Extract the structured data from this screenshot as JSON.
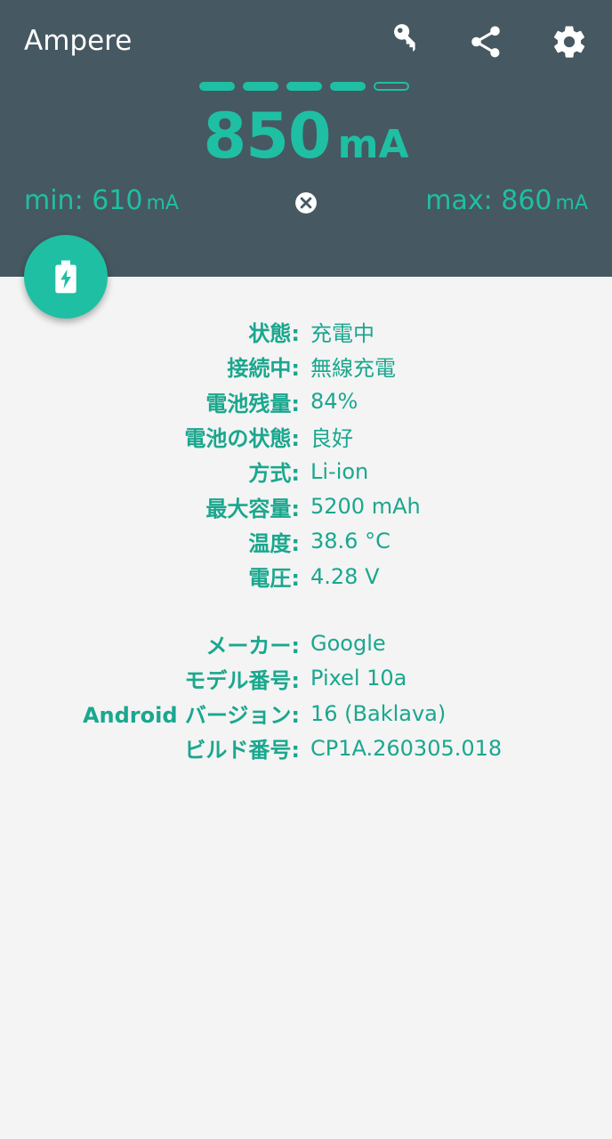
{
  "app": {
    "title": "Ampere"
  },
  "toolbar": {
    "icons": [
      "key-icon",
      "share-icon",
      "settings-icon"
    ]
  },
  "meter": {
    "segments_filled": 4,
    "segments_total": 5,
    "current_value": "850",
    "current_unit": "mA",
    "min_label": "min: 610",
    "min_unit": "mA",
    "max_label": "max: 860",
    "max_unit": "mA"
  },
  "battery": [
    {
      "label": "状態:",
      "value": "充電中"
    },
    {
      "label": "接続中:",
      "value": "無線充電"
    },
    {
      "label": "電池残量:",
      "value": "84%"
    },
    {
      "label": "電池の状態:",
      "value": "良好"
    },
    {
      "label": "方式:",
      "value": "Li-ion"
    },
    {
      "label": "最大容量:",
      "value": "5200 mAh"
    },
    {
      "label": "温度:",
      "value": "38.6 °C"
    },
    {
      "label": "電圧:",
      "value": "4.28 V"
    }
  ],
  "device": [
    {
      "label": "メーカー:",
      "value": "Google"
    },
    {
      "label": "モデル番号:",
      "value": "Pixel 10a"
    },
    {
      "label": "Android バージョン:",
      "value": "16 (Baklava)"
    },
    {
      "label": "ビルド番号:",
      "value": "CP1A.260305.018"
    }
  ],
  "colors": {
    "header": "#465861",
    "accent": "#1fbfa3",
    "background": "#f4f4f4",
    "text_accent": "#1aa78e"
  }
}
